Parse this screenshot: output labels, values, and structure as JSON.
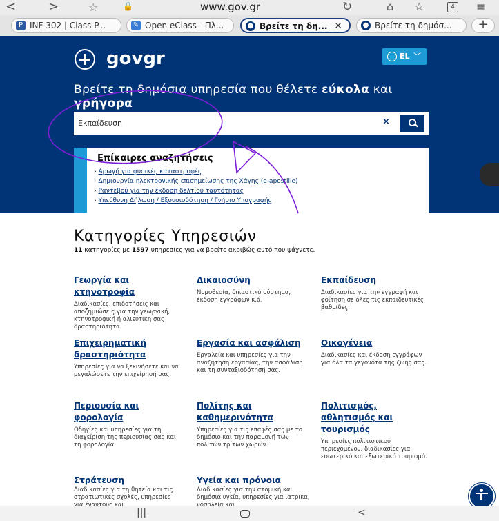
{
  "browser": {
    "back_icon": "chevron-left-icon",
    "forward_icon": "chevron-right-icon",
    "url": "www.gov.gr",
    "tab_count": "4",
    "tabs": [
      {
        "label": "INF 302 | Class P...",
        "favicon_color": "#2c5aa0"
      },
      {
        "label": "Open eClass - Πλ...",
        "favicon_color": "#3a7bd5"
      },
      {
        "label": "Βρείτε τη δη...",
        "favicon_color": "#003476",
        "active": true
      },
      {
        "label": "Βρείτε τη δημόσ...",
        "favicon_color": "#003476"
      }
    ],
    "new_tab": "+"
  },
  "header": {
    "logo_text_gov": "gov",
    "logo_text_gr": "gr",
    "language": "EL"
  },
  "hero": {
    "headline_part1": "Βρείτε τη δημόσια υπηρεσία που θέλετε ",
    "headline_bold1": "εύκολα",
    "headline_part2": " και ",
    "headline_bold2": "γρήγορα",
    "search_value": "Εκπαίδευση",
    "clear_label": "×"
  },
  "recent": {
    "title": "Επίκαιρες αναζητήσεις",
    "items": [
      "Αρωγή για φυσικές καταστροφές",
      "Δημιουργία ηλεκτρονικής επισημείωσης της Χάγης (e-apostille)",
      "Ραντεβού για την έκδοση δελτίου ταυτότητας",
      "Υπεύθυνη Δήλωση / Εξουσιοδότηση / Γνήσιο Υπογραφής"
    ]
  },
  "categories": {
    "title": "Κατηγορίες Υπηρεσιών",
    "count_categories": "11",
    "subtitle_mid": " κατηγορίες με ",
    "count_services": "1597",
    "subtitle_end": " υπηρεσίες για να βρείτε ακριβώς αυτό που ψάχνετε.",
    "items": [
      {
        "title": "Γεωργία και κτηνοτροφία",
        "desc": "Διαδικασίες, επιδοτήσεις και αποζημιώσεις για την γεωργική, κτηνοτροφική ή αλιευτική σας δραστηριότητα."
      },
      {
        "title": "Δικαιοσύνη",
        "desc": "Νομοθεσία, δικαστικό σύστημα, έκδοση εγγράφων κ.ά."
      },
      {
        "title": "Εκπαίδευση",
        "desc": "Διαδικασίες για την εγγραφή και φοίτηση σε όλες τις εκπαιδευτικές βαθμίδες."
      },
      {
        "title": "Επιχειρηματική δραστηριότητα",
        "desc": "Υπηρεσίες για να ξεκινήσετε και να μεγαλώσετε την επιχείρησή σας."
      },
      {
        "title": "Εργασία και ασφάλιση",
        "desc": "Εργαλεία και υπηρεσίες για την αναζήτηση εργασίας, την ασφάλιση και τη συνταξιοδότησή σας."
      },
      {
        "title": "Οικογένεια",
        "desc": "Διαδικασίες και έκδοση εγγράφων για όλα τα γεγονότα της ζωής σας."
      },
      {
        "title": "Περιουσία και φορολογία",
        "desc": "Οδηγίες και υπηρεσίες για τη διαχείριση της περιουσίας σας και τη φορολογία."
      },
      {
        "title": "Πολίτης και καθημερινότητα",
        "desc": "Υπηρεσίες για τις επαφές σας με το δημόσιο και την παραμονή των πολιτών τρίτων χωρών."
      },
      {
        "title": "Πολιτισμός, αθλητισμός και τουρισμός",
        "desc": "Υπηρεσίες πολιτιστικού περιεχομένου, διαδικασίες για εσωτερικό και εξωτερικό τουρισμό."
      },
      {
        "title": "Στράτευση",
        "desc": "Διαδικασίες για τη θητεία και τις στρατιωτικές σχολές, υπηρεσίες για έναντους και"
      },
      {
        "title": "Υγεία και πρόνοια",
        "desc": "Διαδικασίες για την ατομική και δημόσια υγεία, υπηρεσίες για ιατρικα, νοσηλεία και"
      }
    ]
  },
  "android_nav": {
    "recents": "|||",
    "back": "<"
  },
  "colors": {
    "brand_blue": "#003476",
    "accent_cyan": "#1d9bd6",
    "annotation_purple": "#7a1fd6"
  }
}
